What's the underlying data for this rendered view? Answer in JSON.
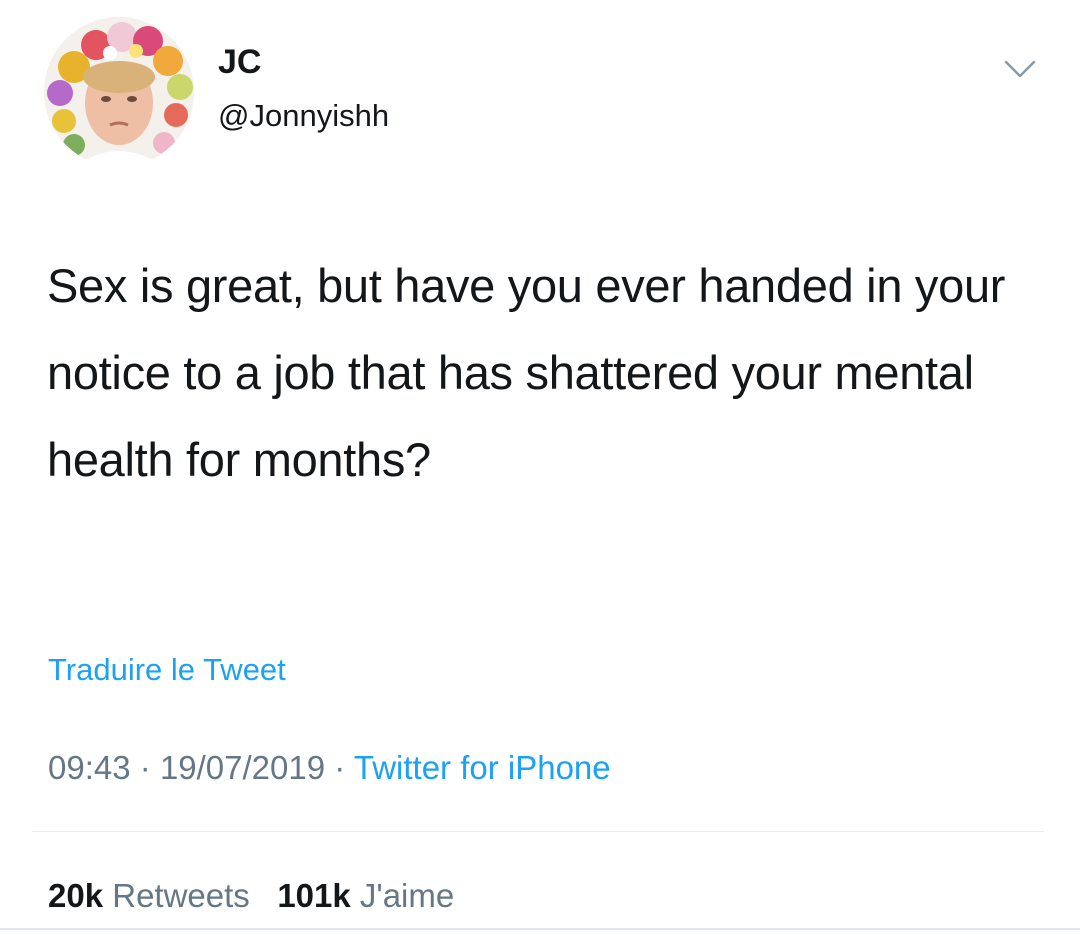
{
  "user": {
    "display_name": "JC",
    "handle": "@Jonnyishh",
    "avatar_icon": "profile-photo-flower-crown"
  },
  "tweet": {
    "text": "Sex is great, but have you ever handed in your notice to a job that has shattered your mental health for months?",
    "translate_label": "Traduire le Tweet",
    "time": "09:43",
    "date": "19/07/2019",
    "separator": "·",
    "source": "Twitter for iPhone"
  },
  "stats": {
    "retweets_count": "20k",
    "retweets_label": "Retweets",
    "likes_count": "101k",
    "likes_label": "J'aime"
  },
  "colors": {
    "link": "#1da1f2",
    "text": "#14171a",
    "muted": "#657786"
  }
}
